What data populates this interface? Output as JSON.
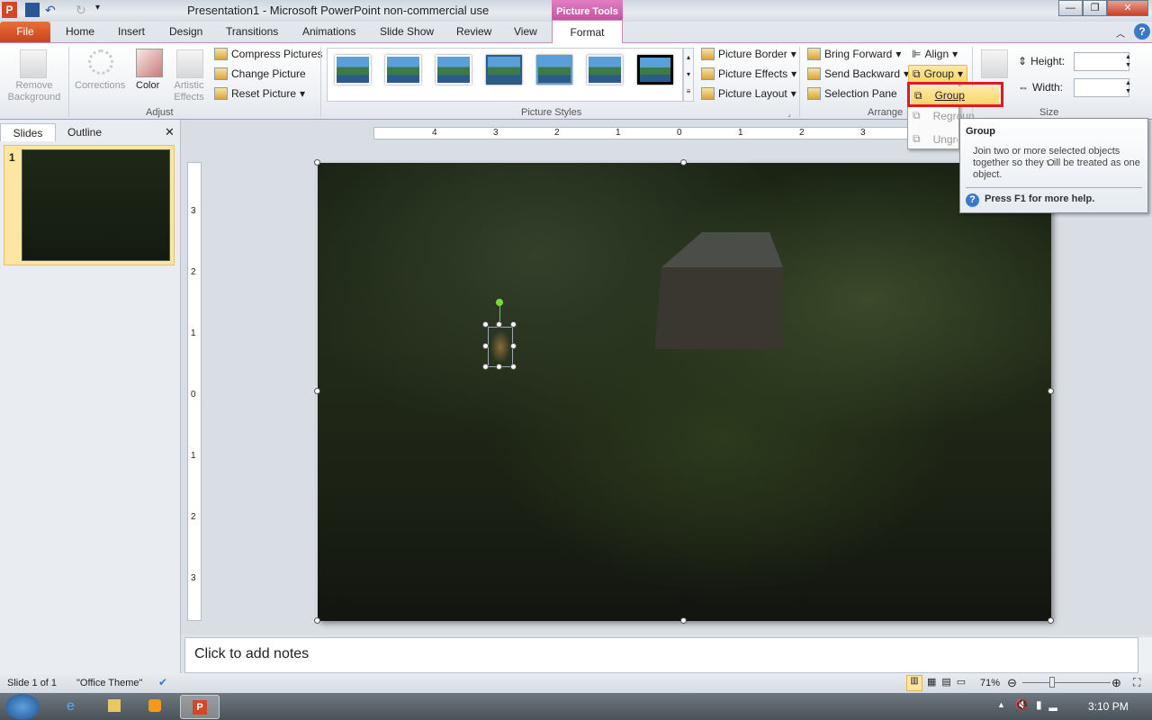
{
  "window": {
    "title": "Presentation1  -  Microsoft PowerPoint non-commercial use",
    "context_tab": "Picture Tools"
  },
  "tabs": [
    "File",
    "Home",
    "Insert",
    "Design",
    "Transitions",
    "Animations",
    "Slide Show",
    "Review",
    "View",
    "Format"
  ],
  "ribbon": {
    "adjust": {
      "label": "Adjust",
      "remove_background": "Remove Background",
      "corrections": "Corrections",
      "color": "Color",
      "artistic_effects": "Artistic Effects",
      "compress": "Compress Pictures",
      "change": "Change Picture",
      "reset": "Reset Picture"
    },
    "picture_styles": {
      "label": "Picture Styles",
      "border": "Picture Border",
      "effects": "Picture Effects",
      "layout": "Picture Layout"
    },
    "arrange": {
      "label": "Arrange",
      "bring_forward": "Bring Forward",
      "send_backward": "Send Backward",
      "selection_pane": "Selection Pane",
      "align": "Align",
      "group": "Group"
    },
    "size": {
      "label": "Size",
      "height_label": "Height:",
      "width_label": "Width:",
      "height_value": "",
      "width_value": ""
    }
  },
  "group_menu": {
    "items": [
      {
        "label": "Group",
        "enabled": true
      },
      {
        "label": "Regroup",
        "enabled": false
      },
      {
        "label": "Ungroup",
        "enabled": false
      }
    ]
  },
  "tooltip": {
    "title": "Group",
    "body": "Join two or more selected objects together so they will be treated as one object.",
    "help": "Press F1 for more help."
  },
  "left_pane": {
    "tabs": [
      "Slides",
      "Outline"
    ],
    "slide_number": "1"
  },
  "ruler": {
    "h": [
      "4",
      "3",
      "2",
      "1",
      "0",
      "1",
      "2",
      "3"
    ],
    "v": [
      "3",
      "2",
      "1",
      "0",
      "1",
      "2",
      "3"
    ]
  },
  "notes": {
    "placeholder": "Click to add notes"
  },
  "status": {
    "slide": "Slide 1 of 1",
    "theme": "\"Office Theme\"",
    "zoom": "71%",
    "zoom_percent": 71
  },
  "taskbar": {
    "clock": "3:10 PM"
  },
  "colors": {
    "file_tab": "#d9531e",
    "context": "#c4509e",
    "highlight": "#ffd966",
    "callout": "#e8161e"
  }
}
